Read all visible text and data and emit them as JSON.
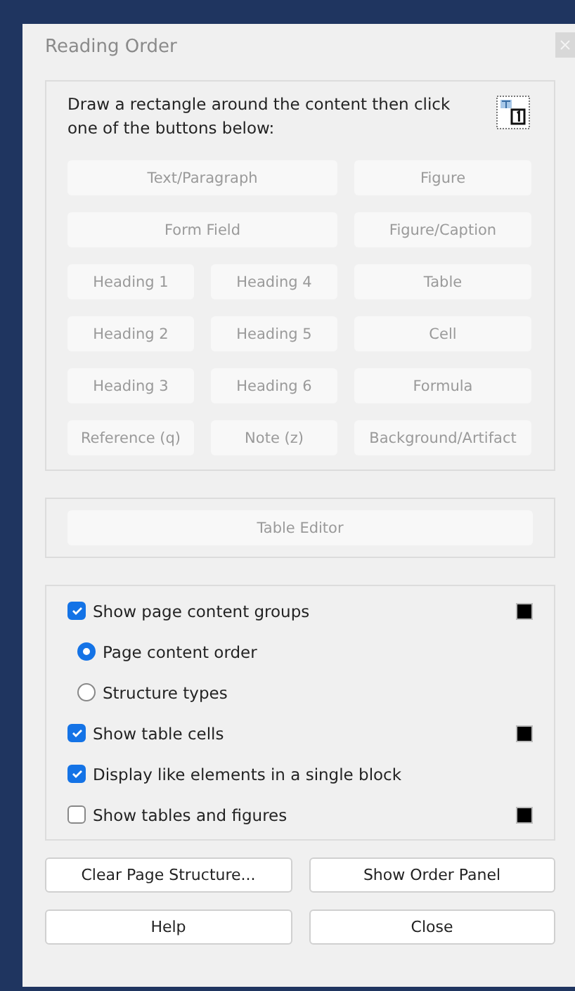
{
  "window": {
    "title": "Reading Order"
  },
  "instructions": "Draw a rectangle around the content then click one of the buttons below:",
  "tag_buttons": [
    {
      "label": "Text/Paragraph",
      "kind": "wide",
      "disabled": true
    },
    {
      "label": "Figure",
      "kind": "normal",
      "disabled": true
    },
    {
      "label": "Form Field",
      "kind": "wide",
      "disabled": true
    },
    {
      "label": "Figure/Caption",
      "kind": "normal",
      "disabled": true
    },
    {
      "label": "Heading 1",
      "kind": "normal",
      "disabled": true
    },
    {
      "label": "Heading 4",
      "kind": "normal",
      "disabled": true
    },
    {
      "label": "Table",
      "kind": "normal",
      "disabled": true
    },
    {
      "label": "Heading 2",
      "kind": "normal",
      "disabled": true
    },
    {
      "label": "Heading 5",
      "kind": "normal",
      "disabled": true
    },
    {
      "label": "Cell",
      "kind": "normal",
      "disabled": true
    },
    {
      "label": "Heading 3",
      "kind": "normal",
      "disabled": true
    },
    {
      "label": "Heading 6",
      "kind": "normal",
      "disabled": true
    },
    {
      "label": "Formula",
      "kind": "normal",
      "disabled": true
    },
    {
      "label": "Reference (q)",
      "kind": "normal",
      "disabled": true
    },
    {
      "label": "Note (z)",
      "kind": "normal",
      "disabled": true
    },
    {
      "label": "Background/Artifact",
      "kind": "normal",
      "disabled": true
    }
  ],
  "table_editor": {
    "label": "Table Editor",
    "disabled": true
  },
  "options": [
    {
      "kind": "checkbox",
      "label": "Show page content groups",
      "checked": true,
      "color": "#000000"
    },
    {
      "kind": "radio",
      "label": "Page content order",
      "selected": true
    },
    {
      "kind": "radio",
      "label": "Structure types",
      "selected": false
    },
    {
      "kind": "checkbox",
      "label": "Show table cells",
      "checked": true,
      "color": "#000000"
    },
    {
      "kind": "checkbox",
      "label": "Display like elements in a single block",
      "checked": true
    },
    {
      "kind": "checkbox",
      "label": "Show tables and figures",
      "checked": false,
      "color": "#000000"
    }
  ],
  "buttons": [
    "Clear Page Structure...",
    "Show Order Panel",
    "Help",
    "Close"
  ]
}
